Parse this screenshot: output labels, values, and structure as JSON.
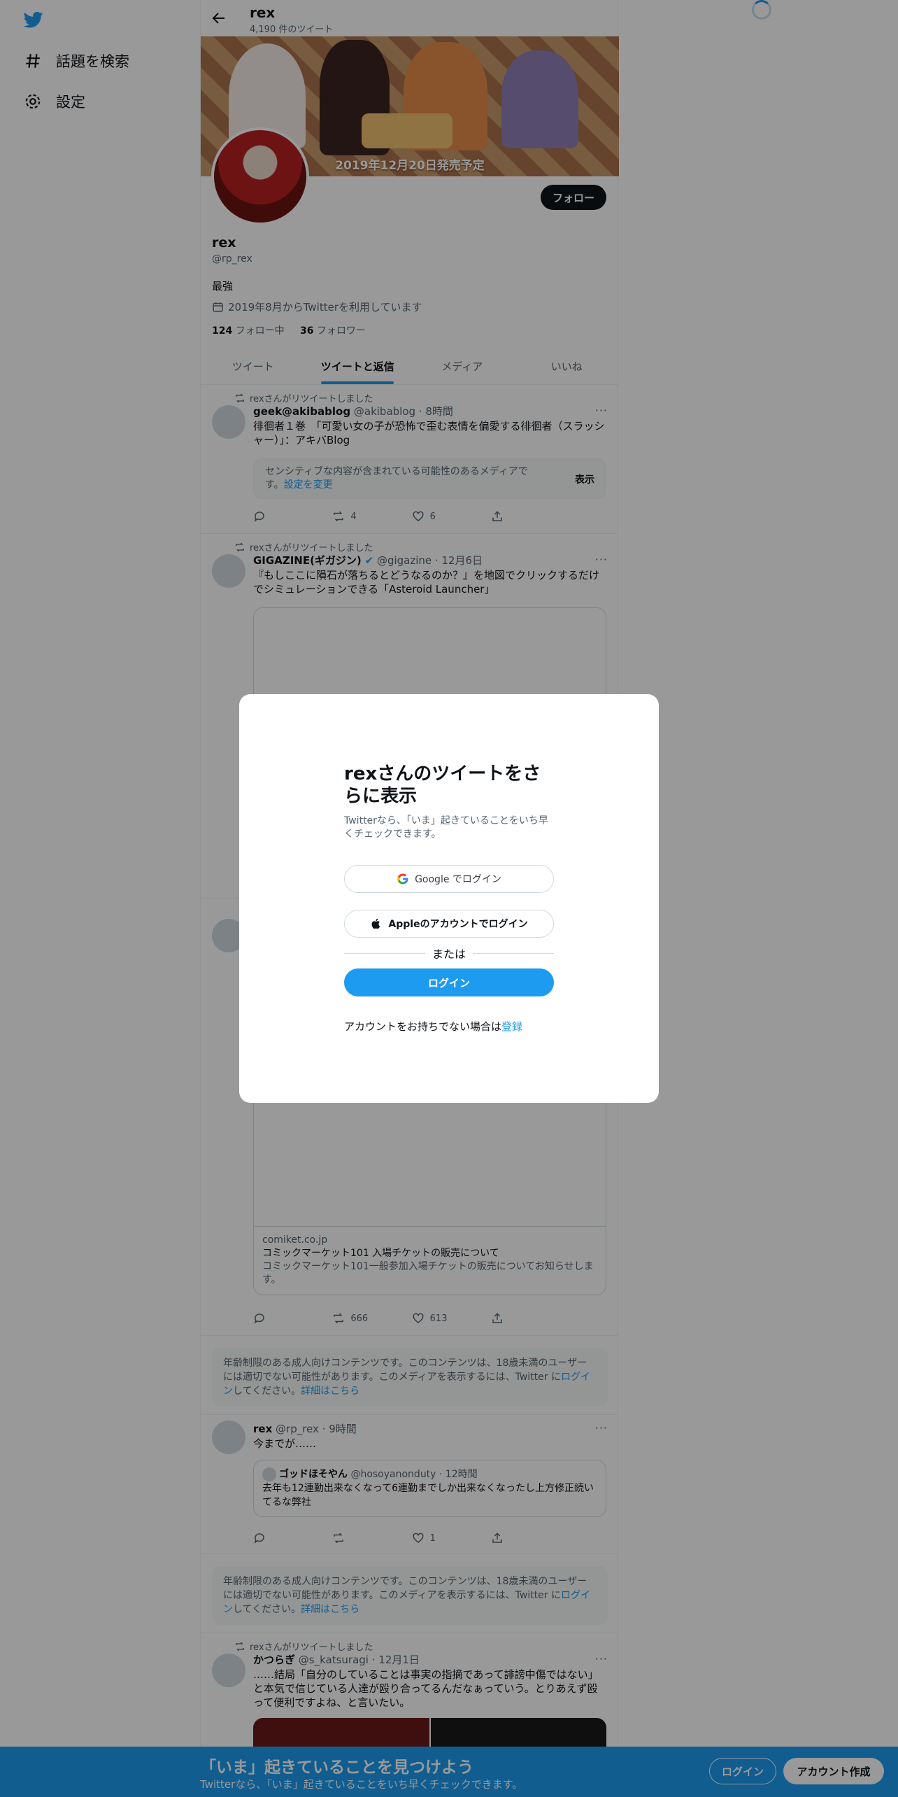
{
  "nav": {
    "explore_label": "話題を検索",
    "settings_label": "設定"
  },
  "header": {
    "name": "rex",
    "tweet_count": "4,190 件のツイート"
  },
  "profile": {
    "banner_text": "2019年12月20日発売予定",
    "follow_label": "フォロー",
    "name": "rex",
    "handle": "@rp_rex",
    "bio": "最強",
    "joined": "2019年8月からTwitterを利用しています",
    "following_count": "124",
    "following_label": "フォロー中",
    "followers_count": "36",
    "followers_label": "フォロワー"
  },
  "tabs": [
    "ツイート",
    "ツイートと返信",
    "メディア",
    "いいね"
  ],
  "tweets": [
    {
      "retweet_label": "rexさんがリツイートしました",
      "name": "geek@akibablog",
      "meta": "@akibablog · 8時間",
      "text": "徘徊者１巻　「可愛い女の子が恐怖で歪む表情を偏愛する徘徊者（スラッシャー）」：アキバBlog",
      "sensitive_text": "センシティブな内容が含まれている可能性のあるメディアです。",
      "sensitive_link": "設定を変更",
      "sensitive_show": "表示",
      "retweets": "4",
      "likes": "6"
    },
    {
      "retweet_label": "rexさんがリツイートしました",
      "name": "GIGAZINE(ギガジン)",
      "meta": "@gigazine · 12月6日",
      "text": "『もしここに隕石が落ちるとどうなるのか？』を地図でクリックするだけでシミュレーションできる「Asteroid Launcher」"
    },
    {
      "card_domain": "comiket.co.jp",
      "card_title": "コミックマーケット101 入場チケットの販売について",
      "card_desc": "コミックマーケット101一般参加入場チケットの販売についてお知らせします。",
      "retweets": "666",
      "likes": "613"
    },
    {
      "name": "rex",
      "meta": "@rp_rex · 9時間",
      "text": "今までが……",
      "quote_name": "ゴッドほそやん",
      "quote_meta": "@hosoyanonduty · 12時間",
      "quote_text": "去年も12連勤出来なくなって6連勤までしか出来なくなったし上方修正続いてるな弊社",
      "likes": "1"
    },
    {
      "retweet_label": "rexさんがリツイートしました",
      "name": "かつらぎ",
      "meta": "@s_katsuragi · 12月1日",
      "text": "……結局「自分のしていることは事実の指摘であって誹謗中傷ではない」と本気で信じている人達が殴り合ってるんだなぁっていう。とりあえず殴って便利ですよね、と言いたい。"
    }
  ],
  "age_gate": {
    "text_before": "年齢制限のある成人向けコンテンツです。このコンテンツは、18歳未満のユーザーには適切でない可能性があります。このメディアを表示するには、Twitter に",
    "login_link": "ログイン",
    "text_middle": "してください。",
    "details_link": "詳細はこちら"
  },
  "modal": {
    "title": "rexさんのツイートをさらに表示",
    "subtitle": "Twitterなら、「いま」起きていることをいち早くチェックできます。",
    "google_label": "Google でログイン",
    "apple_label": "Appleのアカウントでログイン",
    "or_label": "または",
    "login_label": "ログイン",
    "signup_prompt": "アカウントをお持ちでない場合は",
    "signup_link": "登録"
  },
  "bottom_bar": {
    "title": "「いま」起きていることを見つけよう",
    "subtitle": "Twitterなら、「いま」起きていることをいち早くチェックできます。",
    "login_label": "ログイン",
    "signup_label": "アカウント作成"
  },
  "colors": {
    "accent": "#1d9bf0",
    "text_primary": "#0f1419",
    "text_secondary": "#536471"
  },
  "icons": {
    "logo": "twitter-bird-icon",
    "explore": "hashtag-icon",
    "settings": "gear-icon",
    "back": "arrow-left-icon",
    "joined": "calendar-icon"
  }
}
